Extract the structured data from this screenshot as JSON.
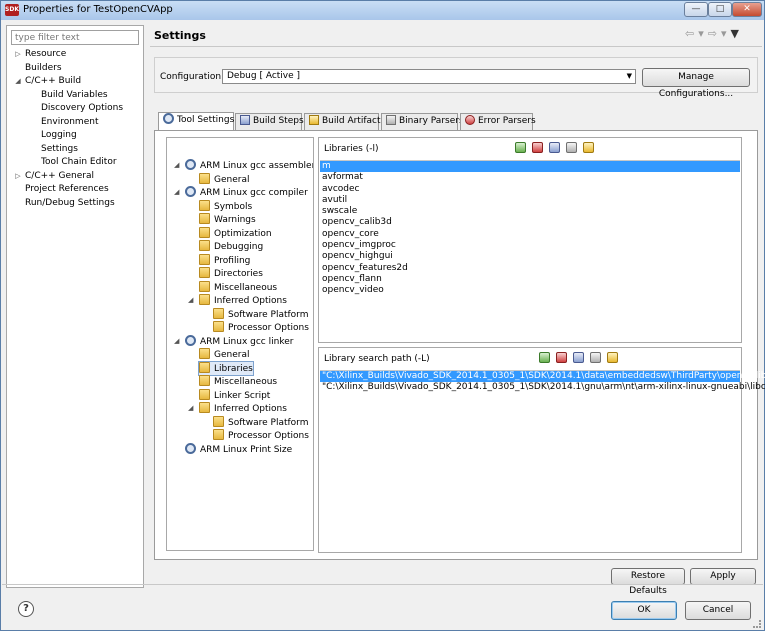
{
  "window": {
    "app_icon": "SDK",
    "title": "Properties for TestOpenCVApp",
    "minimize": "—",
    "maximize": "□",
    "close": "✕"
  },
  "filter": {
    "placeholder": "type filter text"
  },
  "nav": {
    "items": [
      {
        "label": "Resource",
        "twisty": "▷",
        "level": 0
      },
      {
        "label": "Builders",
        "twisty": "",
        "level": 0
      },
      {
        "label": "C/C++ Build",
        "twisty": "◢",
        "level": 0
      },
      {
        "label": "Build Variables",
        "twisty": "",
        "level": 1
      },
      {
        "label": "Discovery Options",
        "twisty": "",
        "level": 1
      },
      {
        "label": "Environment",
        "twisty": "",
        "level": 1
      },
      {
        "label": "Logging",
        "twisty": "",
        "level": 1
      },
      {
        "label": "Settings",
        "twisty": "",
        "level": 1
      },
      {
        "label": "Tool Chain Editor",
        "twisty": "",
        "level": 1
      },
      {
        "label": "C/C++ General",
        "twisty": "▷",
        "level": 0
      },
      {
        "label": "Project References",
        "twisty": "",
        "level": 0
      },
      {
        "label": "Run/Debug Settings",
        "twisty": "",
        "level": 0
      }
    ]
  },
  "header": {
    "title": "Settings",
    "back_icon": "⇦",
    "menu_icon": "▾",
    "forward_icon": "⇨",
    "view_menu_icon": "▼"
  },
  "configuration": {
    "label": "Configuration:",
    "value": "Debug  [ Active ]",
    "dropdown_arrow": "▼",
    "manage_button": "Manage Configurations..."
  },
  "tabs": [
    {
      "label": "Tool Settings",
      "active": true
    },
    {
      "label": "Build Steps",
      "active": false
    },
    {
      "label": "Build Artifact",
      "active": false
    },
    {
      "label": "Binary Parsers",
      "active": false
    },
    {
      "label": "Error Parsers",
      "active": false
    }
  ],
  "tool_tree": [
    {
      "label": "ARM Linux gcc assembler",
      "icon": "gear-icon",
      "twisty": "◢",
      "level": 0
    },
    {
      "label": "General",
      "icon": "folder-icon",
      "twisty": "",
      "level": 1
    },
    {
      "label": "ARM Linux gcc compiler",
      "icon": "gear-icon",
      "twisty": "◢",
      "level": 0
    },
    {
      "label": "Symbols",
      "icon": "folder-icon",
      "twisty": "",
      "level": 1
    },
    {
      "label": "Warnings",
      "icon": "folder-icon",
      "twisty": "",
      "level": 1
    },
    {
      "label": "Optimization",
      "icon": "folder-icon",
      "twisty": "",
      "level": 1
    },
    {
      "label": "Debugging",
      "icon": "folder-icon",
      "twisty": "",
      "level": 1
    },
    {
      "label": "Profiling",
      "icon": "folder-icon",
      "twisty": "",
      "level": 1
    },
    {
      "label": "Directories",
      "icon": "folder-icon",
      "twisty": "",
      "level": 1
    },
    {
      "label": "Miscellaneous",
      "icon": "folder-icon",
      "twisty": "",
      "level": 1
    },
    {
      "label": "Inferred Options",
      "icon": "folder-icon",
      "twisty": "◢",
      "level": 1
    },
    {
      "label": "Software Platform",
      "icon": "folder-icon",
      "twisty": "",
      "level": 2
    },
    {
      "label": "Processor Options",
      "icon": "folder-icon",
      "twisty": "",
      "level": 2
    },
    {
      "label": "ARM Linux gcc linker",
      "icon": "gear-icon",
      "twisty": "◢",
      "level": 0
    },
    {
      "label": "General",
      "icon": "folder-icon",
      "twisty": "",
      "level": 1
    },
    {
      "label": "Libraries",
      "icon": "folder-icon",
      "twisty": "",
      "level": 1,
      "selected": true
    },
    {
      "label": "Miscellaneous",
      "icon": "folder-icon",
      "twisty": "",
      "level": 1
    },
    {
      "label": "Linker Script",
      "icon": "folder-icon",
      "twisty": "",
      "level": 1
    },
    {
      "label": "Inferred Options",
      "icon": "folder-icon",
      "twisty": "◢",
      "level": 1
    },
    {
      "label": "Software Platform",
      "icon": "folder-icon",
      "twisty": "",
      "level": 2
    },
    {
      "label": "Processor Options",
      "icon": "folder-icon",
      "twisty": "",
      "level": 2
    },
    {
      "label": "ARM Linux Print Size",
      "icon": "gear-icon",
      "twisty": "",
      "level": 0
    }
  ],
  "libraries": {
    "title": "Libraries (-l)",
    "items": [
      "m",
      "avformat",
      "avcodec",
      "avutil",
      "swscale",
      "opencv_calib3d",
      "opencv_core",
      "opencv_imgproc",
      "opencv_highgui",
      "opencv_features2d",
      "opencv_flann",
      "opencv_video"
    ],
    "selected_index": 0
  },
  "library_paths": {
    "title": "Library search path (-L)",
    "items": [
      "\"C:\\Xilinx_Builds\\Vivado_SDK_2014.1_0305_1\\SDK\\2014.1\\data\\embeddedsw\\ThirdParty\\opencv\\lib\"",
      "\"C:\\Xilinx_Builds\\Vivado_SDK_2014.1_0305_1\\SDK\\2014.1\\gnu\\arm\\nt\\arm-xilinx-linux-gnueabi\\libc\\lib\""
    ],
    "selected_index": 0
  },
  "buttons": {
    "restore_defaults": "Restore Defaults",
    "apply": "Apply",
    "ok": "OK",
    "cancel": "Cancel",
    "help": "?"
  },
  "colors": {
    "selection": "#3399ff",
    "titlebar": "#b9d1ee"
  }
}
